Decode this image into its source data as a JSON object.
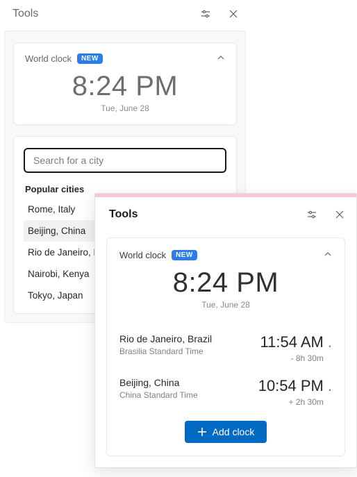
{
  "colors": {
    "accent_blue": "#036ac4",
    "badge_blue": "#2b7de9",
    "front_accent_bar": "#f7c7d6"
  },
  "back_panel": {
    "title": "Tools",
    "world_clock": {
      "label": "World clock",
      "badge": "NEW",
      "time": "8:24 PM",
      "date": "Tue, June 28"
    },
    "search": {
      "placeholder": "Search for a city",
      "value": ""
    },
    "popular_label": "Popular cities",
    "popular_cities": [
      {
        "label": "Rome, Italy",
        "hovered": false
      },
      {
        "label": "Beijing, China",
        "hovered": true
      },
      {
        "label": "Rio de Janeiro, Brazil",
        "hovered": false
      },
      {
        "label": "Nairobi, Kenya",
        "hovered": false
      },
      {
        "label": "Tokyo, Japan",
        "hovered": false
      }
    ]
  },
  "front_panel": {
    "title": "Tools",
    "world_clock": {
      "label": "World clock",
      "badge": "NEW",
      "time": "8:24 PM",
      "date": "Tue, June 28"
    },
    "clocks": [
      {
        "city": "Rio de Janeiro, Brazil",
        "timezone": "Brasilia Standard Time",
        "time": "11:54 AM",
        "offset": "- 8h 30m"
      },
      {
        "city": "Beijing, China",
        "timezone": "China Standard Time",
        "time": "10:54 PM",
        "offset": "+ 2h 30m"
      }
    ],
    "add_clock_label": "Add clock"
  }
}
